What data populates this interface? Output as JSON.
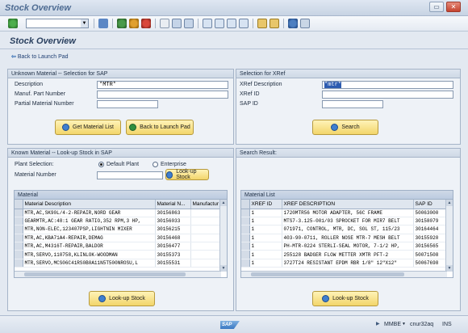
{
  "window": {
    "title": "Stock Overview",
    "restore_glyph": "▭",
    "close_glyph": "✕"
  },
  "page": {
    "title": "Stock Overview",
    "back_link": "Back to Launch Pad"
  },
  "unknown": {
    "title": "Unknown Material -- Selection for SAP",
    "labels": {
      "description": "Description",
      "manuf": "Manuf. Part Number",
      "partial": "Partial Material Number"
    },
    "values": {
      "description": "*MTR*",
      "manuf": "",
      "partial": ""
    },
    "buttons": {
      "get": "Get Material List",
      "back": "Back to Launch Pad"
    }
  },
  "xref": {
    "title": "Selection for XRef",
    "labels": {
      "description": "XRef Description",
      "id": "XRef ID",
      "sap_id": "SAP ID"
    },
    "values": {
      "description": "*mtr*",
      "id": "",
      "sap_id": ""
    },
    "buttons": {
      "search": "Search"
    }
  },
  "known": {
    "title": "Known Material -- Look-up Stock in SAP",
    "plant_label": "Plant Selection:",
    "plant_options": [
      "Default Plant",
      "Enterprise"
    ],
    "plant_selected": "Default Plant",
    "matnum_label": "Material Number",
    "matnum_value": "",
    "lookup_inline": "Look-up Stock",
    "table": {
      "caption": "Material",
      "columns": [
        "Material Description",
        "Material N...",
        "Manufactur"
      ],
      "rows": [
        [
          "MTR,AC,SK90L/4-2-REPAIR,NORD GEAR",
          "30156863",
          ""
        ],
        [
          "GEARMTR,AC:48:1 GEAR RATIO,352 RPM,3 HP,",
          "30156033",
          ""
        ],
        [
          "MTR,NON-ELEC,123407PSP,LIGHTNIN MIXER",
          "30156215",
          ""
        ],
        [
          "MTR,AC,KBA71A4-REPAIR,DEMAG",
          "30156468",
          ""
        ],
        [
          "MTR,AC,M4316T-REPAIR,BALDOR",
          "30156477",
          ""
        ],
        [
          "MTR,SERVO,110758,KLINLOK-WOODMAN",
          "30155373",
          ""
        ],
        [
          "MTR,SERVO,MCS06C41RS0B0A11N5T500NROSU,L",
          "30155531",
          ""
        ]
      ]
    },
    "lookup_button": "Look-up Stock"
  },
  "search": {
    "title": "Search Result:",
    "table": {
      "caption": "Material List",
      "columns": [
        "XREF ID",
        "XREF DESCRIPTION",
        "SAP ID"
      ],
      "rows": [
        [
          "1",
          "1720MTR56 MOTOR ADAPTER, 56C FRAME",
          "50063000"
        ],
        [
          "1",
          "MTS7-3.125-001/03 SPROCKET FOR MIR7 BELT",
          "30158079"
        ],
        [
          "1",
          "071971, CONTROL, MTR, DC, SOL ST, 115/23",
          "30164464"
        ],
        [
          "1",
          "403-90-0711, ROLLER NOSE MTR-7 MESH BELT",
          "30155920"
        ],
        [
          "1",
          "PH-MTR-0224 STERLI-SEAL MOTOR, 7-1/2 HP,",
          "30156565"
        ],
        [
          "1",
          "255128 BADGER FLOW METTER XMTR PFT-2",
          "50071508"
        ],
        [
          "1",
          "3727T24 RESISTANT EPDM RBR 1/8\" 12\"X12\"",
          "50067698"
        ]
      ]
    },
    "lookup_button": "Look-up Stock"
  },
  "statusbar": {
    "transaction": "MMBE",
    "server": "cnur32aq",
    "mode": "INS",
    "logo": "SAP"
  },
  "colors": {
    "accent": "#f2d56a",
    "title": "#4f6c93",
    "selection": "#2d5cb0"
  }
}
